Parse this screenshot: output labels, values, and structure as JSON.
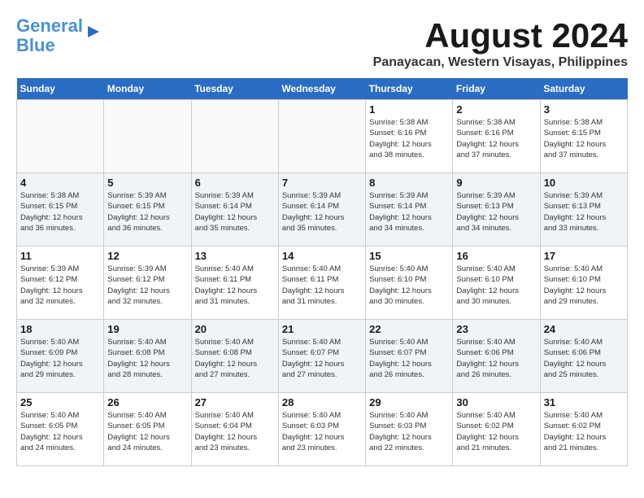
{
  "header": {
    "logo_line1": "General",
    "logo_line2": "Blue",
    "title": "August 2024",
    "subtitle": "Panayacan, Western Visayas, Philippines"
  },
  "days_of_week": [
    "Sunday",
    "Monday",
    "Tuesday",
    "Wednesday",
    "Thursday",
    "Friday",
    "Saturday"
  ],
  "weeks": [
    [
      {
        "num": "",
        "info": ""
      },
      {
        "num": "",
        "info": ""
      },
      {
        "num": "",
        "info": ""
      },
      {
        "num": "",
        "info": ""
      },
      {
        "num": "1",
        "info": "Sunrise: 5:38 AM\nSunset: 6:16 PM\nDaylight: 12 hours\nand 38 minutes."
      },
      {
        "num": "2",
        "info": "Sunrise: 5:38 AM\nSunset: 6:16 PM\nDaylight: 12 hours\nand 37 minutes."
      },
      {
        "num": "3",
        "info": "Sunrise: 5:38 AM\nSunset: 6:15 PM\nDaylight: 12 hours\nand 37 minutes."
      }
    ],
    [
      {
        "num": "4",
        "info": "Sunrise: 5:38 AM\nSunset: 6:15 PM\nDaylight: 12 hours\nand 36 minutes."
      },
      {
        "num": "5",
        "info": "Sunrise: 5:39 AM\nSunset: 6:15 PM\nDaylight: 12 hours\nand 36 minutes."
      },
      {
        "num": "6",
        "info": "Sunrise: 5:39 AM\nSunset: 6:14 PM\nDaylight: 12 hours\nand 35 minutes."
      },
      {
        "num": "7",
        "info": "Sunrise: 5:39 AM\nSunset: 6:14 PM\nDaylight: 12 hours\nand 35 minutes."
      },
      {
        "num": "8",
        "info": "Sunrise: 5:39 AM\nSunset: 6:14 PM\nDaylight: 12 hours\nand 34 minutes."
      },
      {
        "num": "9",
        "info": "Sunrise: 5:39 AM\nSunset: 6:13 PM\nDaylight: 12 hours\nand 34 minutes."
      },
      {
        "num": "10",
        "info": "Sunrise: 5:39 AM\nSunset: 6:13 PM\nDaylight: 12 hours\nand 33 minutes."
      }
    ],
    [
      {
        "num": "11",
        "info": "Sunrise: 5:39 AM\nSunset: 6:12 PM\nDaylight: 12 hours\nand 32 minutes."
      },
      {
        "num": "12",
        "info": "Sunrise: 5:39 AM\nSunset: 6:12 PM\nDaylight: 12 hours\nand 32 minutes."
      },
      {
        "num": "13",
        "info": "Sunrise: 5:40 AM\nSunset: 6:11 PM\nDaylight: 12 hours\nand 31 minutes."
      },
      {
        "num": "14",
        "info": "Sunrise: 5:40 AM\nSunset: 6:11 PM\nDaylight: 12 hours\nand 31 minutes."
      },
      {
        "num": "15",
        "info": "Sunrise: 5:40 AM\nSunset: 6:10 PM\nDaylight: 12 hours\nand 30 minutes."
      },
      {
        "num": "16",
        "info": "Sunrise: 5:40 AM\nSunset: 6:10 PM\nDaylight: 12 hours\nand 30 minutes."
      },
      {
        "num": "17",
        "info": "Sunrise: 5:40 AM\nSunset: 6:10 PM\nDaylight: 12 hours\nand 29 minutes."
      }
    ],
    [
      {
        "num": "18",
        "info": "Sunrise: 5:40 AM\nSunset: 6:09 PM\nDaylight: 12 hours\nand 29 minutes."
      },
      {
        "num": "19",
        "info": "Sunrise: 5:40 AM\nSunset: 6:08 PM\nDaylight: 12 hours\nand 28 minutes."
      },
      {
        "num": "20",
        "info": "Sunrise: 5:40 AM\nSunset: 6:08 PM\nDaylight: 12 hours\nand 27 minutes."
      },
      {
        "num": "21",
        "info": "Sunrise: 5:40 AM\nSunset: 6:07 PM\nDaylight: 12 hours\nand 27 minutes."
      },
      {
        "num": "22",
        "info": "Sunrise: 5:40 AM\nSunset: 6:07 PM\nDaylight: 12 hours\nand 26 minutes."
      },
      {
        "num": "23",
        "info": "Sunrise: 5:40 AM\nSunset: 6:06 PM\nDaylight: 12 hours\nand 26 minutes."
      },
      {
        "num": "24",
        "info": "Sunrise: 5:40 AM\nSunset: 6:06 PM\nDaylight: 12 hours\nand 25 minutes."
      }
    ],
    [
      {
        "num": "25",
        "info": "Sunrise: 5:40 AM\nSunset: 6:05 PM\nDaylight: 12 hours\nand 24 minutes."
      },
      {
        "num": "26",
        "info": "Sunrise: 5:40 AM\nSunset: 6:05 PM\nDaylight: 12 hours\nand 24 minutes."
      },
      {
        "num": "27",
        "info": "Sunrise: 5:40 AM\nSunset: 6:04 PM\nDaylight: 12 hours\nand 23 minutes."
      },
      {
        "num": "28",
        "info": "Sunrise: 5:40 AM\nSunset: 6:03 PM\nDaylight: 12 hours\nand 23 minutes."
      },
      {
        "num": "29",
        "info": "Sunrise: 5:40 AM\nSunset: 6:03 PM\nDaylight: 12 hours\nand 22 minutes."
      },
      {
        "num": "30",
        "info": "Sunrise: 5:40 AM\nSunset: 6:02 PM\nDaylight: 12 hours\nand 21 minutes."
      },
      {
        "num": "31",
        "info": "Sunrise: 5:40 AM\nSunset: 6:02 PM\nDaylight: 12 hours\nand 21 minutes."
      }
    ]
  ]
}
